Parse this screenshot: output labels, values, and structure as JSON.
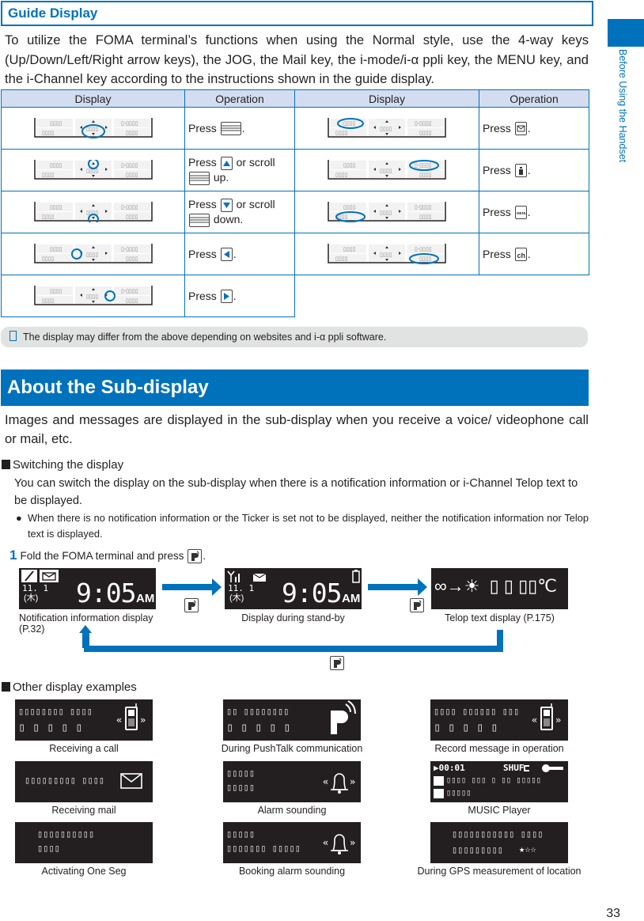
{
  "side_tab": {
    "label": "Before Using the Handset",
    "color": "#0072bc"
  },
  "guide": {
    "heading": "Guide Display",
    "intro": "To utilize the FOMA terminal’s functions when using the Normal style, use the 4-way keys (Up/Down/Left/Right arrow keys), the JOG, the Mail key, the i-mode/i-α ppli key, the MENU key, and the i-Channel key according to the instructions shown in the guide display.",
    "table": {
      "headers": [
        "Display",
        "Operation",
        "Display",
        "Operation"
      ],
      "left_rows": [
        {
          "highlight": "center",
          "pre": "Press",
          "key": "jog-key-icon",
          "post": "."
        },
        {
          "highlight": "up",
          "pre": "Press",
          "key": "up-arrow-key-icon",
          "mid": "or scroll",
          "key2": "jog-key-icon",
          "post": "up."
        },
        {
          "highlight": "down",
          "pre": "Press",
          "key": "down-arrow-key-icon",
          "mid": "or scroll",
          "key2": "jog-key-icon",
          "post": "down."
        },
        {
          "highlight": "left",
          "pre": "Press",
          "key": "left-arrow-key-icon",
          "post": "."
        },
        {
          "highlight": "right",
          "pre": "Press",
          "key": "right-arrow-key-icon",
          "post": "."
        }
      ],
      "right_rows": [
        {
          "highlight": "top-left",
          "pre": "Press",
          "key": "mail-key-icon",
          "post": "."
        },
        {
          "highlight": "top-right",
          "pre": "Press",
          "key": "imode-key-icon",
          "post": "."
        },
        {
          "highlight": "bottom-left",
          "pre": "Press",
          "key": "menu-key-icon",
          "post": "."
        },
        {
          "highlight": "bottom-right",
          "pre": "Press",
          "key": "ichannel-key-icon",
          "post": "."
        }
      ]
    },
    "note": "The display may differ from the above depending on websites and i-α ppli software."
  },
  "subdisplay": {
    "heading": "About the Sub-display",
    "intro": "Images and messages are displayed in the sub-display when you receive a voice/ videophone call or mail, etc.",
    "switching": {
      "title": "Switching the display",
      "body": "You can switch the display on the sub-display when there is a notification information or i-Channel Telop text to be displayed.",
      "bullet": "When there is no notification information or the Ticker is set not to be displayed, neither the notification information nor Telop text is displayed.",
      "step_number": "1",
      "step_text": "Fold the FOMA terminal and press",
      "screens": [
        {
          "caption": "Notification information display (P.32)",
          "date": "11. 1",
          "day": "(木)",
          "time": "9:05",
          "ampm": "AM"
        },
        {
          "caption": "Display during stand-by",
          "date": "11. 1",
          "day": "(木)",
          "time": "9:05",
          "ampm": "AM"
        },
        {
          "caption": "Telop text display (P.175)",
          "telop": "∞→☀  ▯ ▯ ▯▯℃"
        }
      ]
    },
    "examples": {
      "title": "Other display examples",
      "items": [
        {
          "caption": "Receiving a call",
          "line1": "▯▯▯▯▯▯▯▯ ▯▯▯▯",
          "line2": "▯ ▯ ▯ ▯ ▯",
          "icon": "phone-ringing-icon"
        },
        {
          "caption": "During PushTalk communication",
          "line1": "▯▯ ▯▯▯▯▯▯▯▯",
          "line2": "▯ ▯ ▯ ▯ ▯",
          "icon": "pushtalk-icon"
        },
        {
          "caption": "Record message in operation",
          "line1": "▯▯▯▯ ▯▯▯▯▯▯ ▯▯▯",
          "line2": "▯ ▯ ▯ ▯ ▯",
          "icon": "phone-ringing-icon"
        },
        {
          "caption": "Receiving mail",
          "line1": "▯▯▯▯▯▯▯▯▯ ▯▯▯▯",
          "line2": "",
          "icon": "mail-icon"
        },
        {
          "caption": "Alarm sounding",
          "line1": "▯▯▯▯▯",
          "line2": "▯▯▯▯▯",
          "icon": "alarm-bell-icon"
        },
        {
          "caption": "MUSIC Player",
          "line1": "▶00:01",
          "line1b": "SHUF",
          "line2": "▯▯▯▯ ▯▯▯ ▯ ▯▯ ▯▯▯▯▯",
          "line3": "▯▯▯▯▯",
          "icon": "music-player-icon"
        },
        {
          "caption": "Activating One Seg",
          "line1": "▯▯▯▯▯▯▯▯▯▯",
          "line2": "▯▯▯▯",
          "icon": ""
        },
        {
          "caption": "Booking alarm sounding",
          "line1": "▯▯▯▯▯",
          "line2": "▯▯▯▯▯▯▯ ▯▯▯▯▯",
          "icon": "alarm-bell-icon"
        },
        {
          "caption": "During GPS measurement of location",
          "line1": "▯▯▯▯▯▯▯▯▯▯▯ ▯▯▯▯",
          "line2": "▯▯▯▯▯▯▯▯▯",
          "stars": "★☆☆",
          "icon": ""
        }
      ]
    }
  },
  "page_number": "33"
}
